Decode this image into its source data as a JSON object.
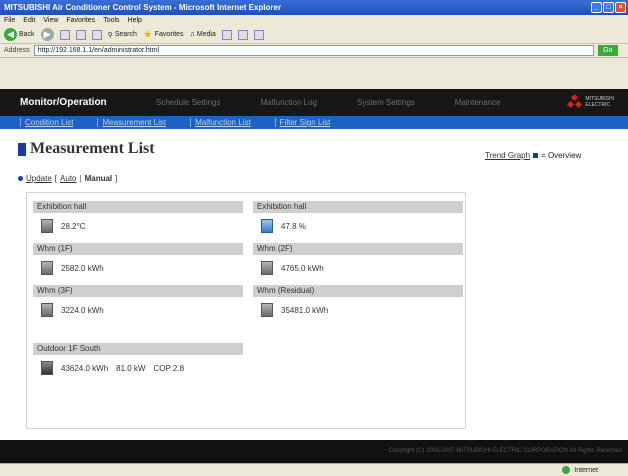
{
  "browser": {
    "title": "MITSUBISHI Air Conditioner Control System - Microsoft Internet Explorer",
    "menu": [
      "File",
      "Edit",
      "View",
      "Favorites",
      "Tools",
      "Help"
    ],
    "toolbar": {
      "back": "Back",
      "search": "Search",
      "favorites": "Favorites",
      "media": "Media"
    },
    "address_label": "Address",
    "address": "http://192.168.1.1/en/administrator.html",
    "go": "Go",
    "status": "Internet"
  },
  "nav": {
    "main": "Monitor/Operation",
    "items": [
      "Schedule Settings",
      "Malfunction Log",
      "System Settings",
      "Maintenance"
    ],
    "sub": [
      "Condition List",
      "Measurement List",
      "Malfunction List",
      "Filter Sign List"
    ],
    "brand": [
      "MITSUBISHI",
      "ELECTRIC"
    ]
  },
  "page": {
    "title": "Measurement List",
    "trend_link": "Trend Graph",
    "overview": "= Overview",
    "update": "Update",
    "bracket_open": "[",
    "auto": "Auto",
    "manual": "Manual",
    "bracket_close": "]"
  },
  "measurements": [
    {
      "label": "Exhibition hall",
      "value": "28.2°C",
      "icon": "temperature-sensor-icon"
    },
    {
      "label": "Exhibition hall",
      "value": "47.8 %",
      "icon": "humidity-sensor-icon"
    },
    {
      "label": "Whm (1F)",
      "value": "2582.0 kWh",
      "icon": "watt-hour-meter-icon"
    },
    {
      "label": "Whm (2F)",
      "value": "4765.0 kWh",
      "icon": "watt-hour-meter-icon"
    },
    {
      "label": "Whm (3F)",
      "value": "3224.0 kWh",
      "icon": "watt-hour-meter-icon"
    },
    {
      "label": "Whm (Residual)",
      "value": "35481.0 kWh",
      "icon": "watt-hour-meter-icon"
    }
  ],
  "outdoor": {
    "label": "Outdoor 1F South",
    "energy": "43624.0 kWh",
    "power": "81.0 kW",
    "cop": "COP 2.8"
  },
  "footer": "Copyright (C) 2003-2007 MITSUBISHI ELECTRIC CORPORATION All Rights Reserved"
}
